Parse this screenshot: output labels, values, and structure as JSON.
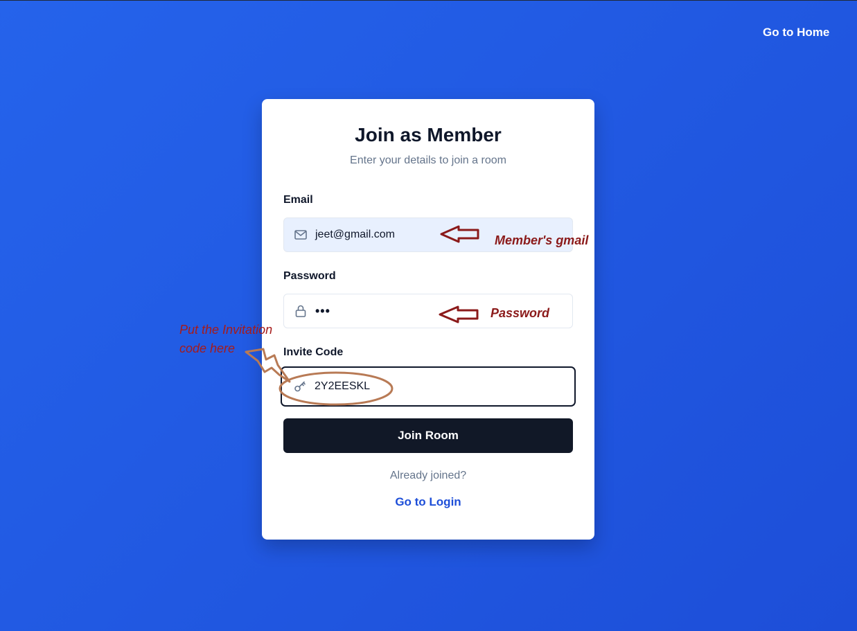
{
  "header": {
    "home_link": "Go to Home"
  },
  "card": {
    "title": "Join as Member",
    "subtitle": "Enter your details to join a room"
  },
  "form": {
    "email": {
      "label": "Email",
      "value": "jeet@gmail.com",
      "icon": "mail-icon"
    },
    "password": {
      "label": "Password",
      "value": "•••",
      "icon": "lock-icon"
    },
    "invite": {
      "label": "Invite Code",
      "value": "2Y2EESKL",
      "icon": "key-icon"
    },
    "submit_label": "Join Room"
  },
  "footer": {
    "prompt": "Already joined?",
    "login_link": "Go to Login"
  },
  "annotations": {
    "email_note": "Member's gmail",
    "password_note": "Password",
    "invite_note_line1": "Put the Invitation",
    "invite_note_line2": "code here"
  },
  "colors": {
    "background": "#2563eb",
    "button": "#111827",
    "link": "#1d4ed8",
    "annotation": "#8b1a1a",
    "highlight_circle": "#b87a55"
  }
}
